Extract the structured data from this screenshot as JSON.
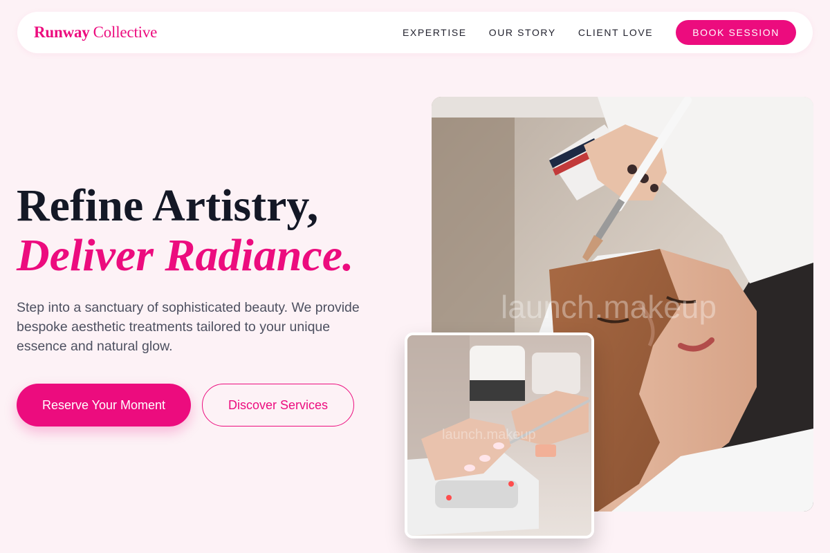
{
  "nav": {
    "brand_bold": "Runway",
    "brand_regular": "Collective",
    "links": [
      "EXPERTISE",
      "OUR STORY",
      "CLIENT LOVE"
    ],
    "cta": "BOOK SESSION"
  },
  "hero": {
    "title_line1": "Refine Artistry,",
    "title_line2": "Deliver Radiance.",
    "description": "Step into a sanctuary of sophisticated beauty. We provide bespoke aesthetic treatments tailored to your unique essence and natural glow.",
    "primary_button": "Reserve Your Moment",
    "secondary_button": "Discover Services"
  },
  "images": {
    "main_watermark": "launch.makeup",
    "inset_watermark": "launch.makeup"
  },
  "colors": {
    "accent": "#ec0c7e",
    "page_bg": "#fdf2f6",
    "heading": "#141826",
    "body_text": "#4d5060"
  }
}
